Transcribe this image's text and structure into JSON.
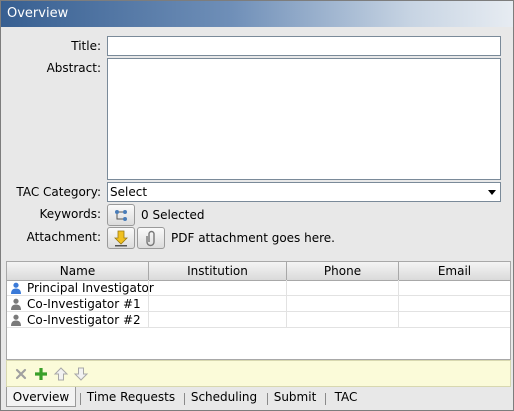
{
  "window": {
    "title": "Overview"
  },
  "form": {
    "title_label": "Title:",
    "title_value": "",
    "abstract_label": "Abstract:",
    "abstract_value": "",
    "tac_label": "TAC Category:",
    "tac_value": "Select",
    "keywords_label": "Keywords:",
    "keywords_text": "0 Selected",
    "attachment_label": "Attachment:",
    "attachment_text": "PDF attachment goes here."
  },
  "table": {
    "columns": [
      "Name",
      "Institution",
      "Phone",
      "Email"
    ],
    "rows": [
      {
        "name": "Principal Investigator",
        "institution": "",
        "phone": "",
        "email": "",
        "icon": "user-blue-icon"
      },
      {
        "name": "Co-Investigator #1",
        "institution": "",
        "phone": "",
        "email": "",
        "icon": "user-gray-icon"
      },
      {
        "name": "Co-Investigator #2",
        "institution": "",
        "phone": "",
        "email": "",
        "icon": "user-gray-icon"
      }
    ]
  },
  "tabs": [
    {
      "label": "Overview",
      "active": true
    },
    {
      "label": "Time Requests",
      "active": false
    },
    {
      "label": "Scheduling",
      "active": false
    },
    {
      "label": "Submit",
      "active": false
    },
    {
      "label": "TAC",
      "active": false
    }
  ],
  "colors": {
    "accent": "#375f91",
    "toolbar_bg": "#fbfbd9"
  }
}
